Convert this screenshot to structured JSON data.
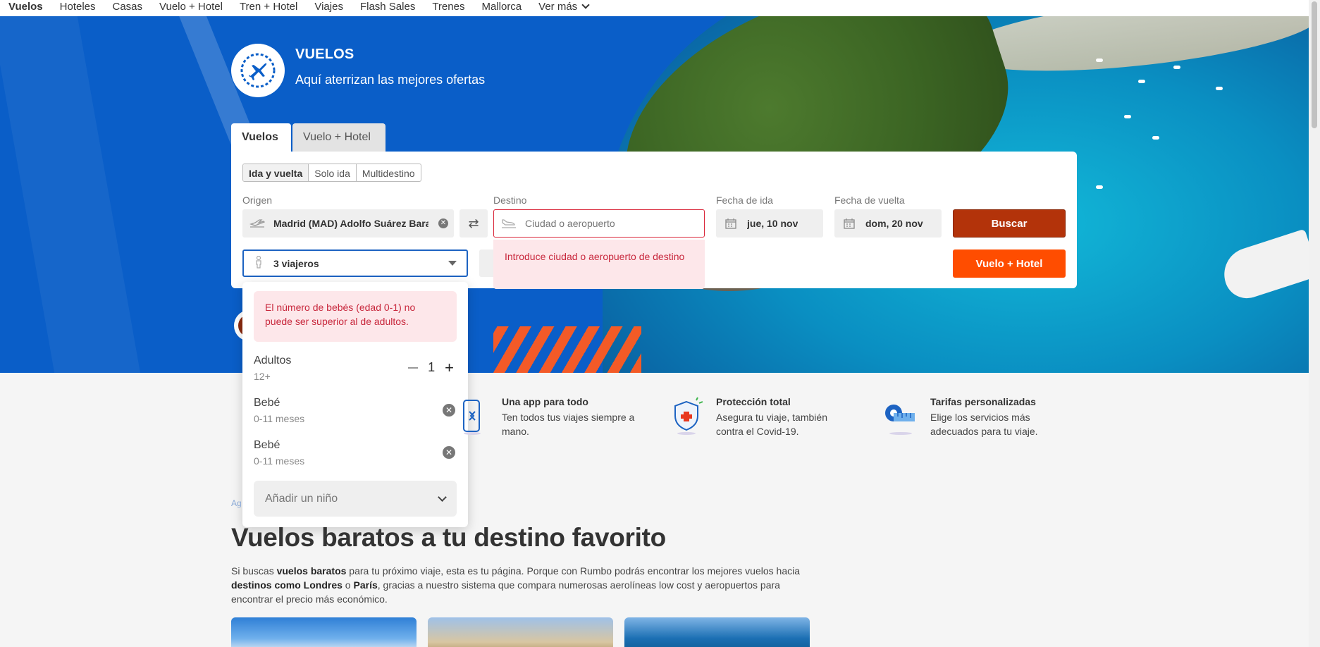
{
  "nav": {
    "items": [
      "Vuelos",
      "Hoteles",
      "Casas",
      "Vuelo + Hotel",
      "Tren + Hotel",
      "Viajes",
      "Flash Sales",
      "Trenes",
      "Mallorca"
    ],
    "more_label": "Ver más"
  },
  "hero": {
    "title": "VUELOS",
    "subtitle": "Aquí aterrizan las mejores ofertas"
  },
  "search": {
    "tabs": [
      "Vuelos",
      "Vuelo + Hotel"
    ],
    "trip_types": [
      "Ida y vuelta",
      "Solo ida",
      "Multidestino"
    ],
    "origin_label": "Origen",
    "origin_value": "Madrid (MAD) Adolfo Suárez Barajas",
    "destination_label": "Destino",
    "destination_placeholder": "Ciudad o aeropuerto",
    "depart_label": "Fecha de ida",
    "depart_value": "jue, 10 nov",
    "return_label": "Fecha de vuelta",
    "return_value": "dom, 20 nov",
    "search_button": "Buscar",
    "flight_hotel_button": "Vuelo + Hotel",
    "destination_error": "Introduce ciudad o aeropuerto de destino",
    "travellers_value": "3 viajeros"
  },
  "travellers_dropdown": {
    "error": "El número de bebés (edad 0-1) no puede ser superior al de adultos.",
    "adults_label": "Adultos",
    "adults_sub": "12+",
    "adults_count": "1",
    "infants": [
      {
        "label": "Bebé",
        "sub": "0-11 meses"
      },
      {
        "label": "Bebé",
        "sub": "0-11 meses"
      }
    ],
    "add_child": "Añadir un niño"
  },
  "features": [
    {
      "title": "Una app para todo",
      "desc": "Ten todos tus viajes siempre a mano."
    },
    {
      "title": "Protección total",
      "desc": "Asegura tu viaje, también contra el Covid-19."
    },
    {
      "title": "Tarifas personalizadas",
      "desc": "Elige los servicios más adecuados para tu viaje."
    }
  ],
  "content": {
    "crumb": "Ag",
    "heading": "Vuelos baratos a tu destino favorito",
    "intro_1": "Si buscas ",
    "intro_b1": "vuelos baratos",
    "intro_2": " para tu próximo viaje, esta es tu página. Porque con Rumbo podrás encontrar los mejores vuelos hacia ",
    "intro_b2": "destinos como Londres",
    "intro_3": " o ",
    "intro_b3": "París",
    "intro_4": ", gracias a nuestro sistema que compara numerosas aerolíneas low cost y aeropuertos para encontrar el precio más económico."
  },
  "colors": {
    "hero_blue": "#0a5ec8",
    "search_button": "#b3330a",
    "accent_orange": "#ff4d00",
    "error_red": "#c8273c",
    "focus_blue": "#1d63c2"
  }
}
